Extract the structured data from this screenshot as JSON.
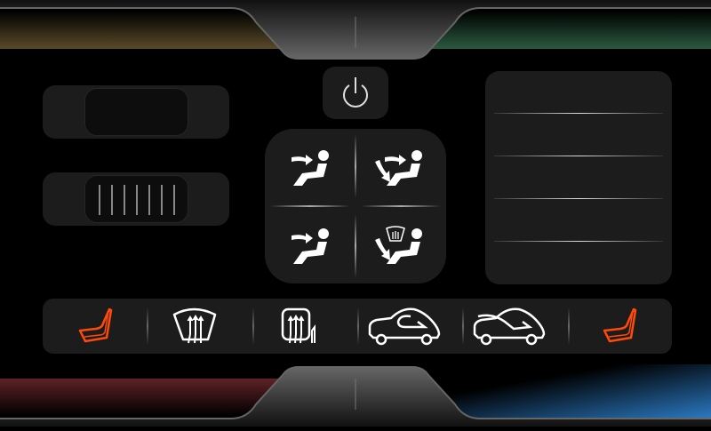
{
  "theme": {
    "background": "#000000",
    "panel": "#1c1c1c",
    "accent_seat_heat": "#ff4a0a",
    "top_left_band": "#5a4a28",
    "top_right_band": "#2a5a40",
    "bottom_left_band": "#5e2226",
    "bottom_right_band": "#2a78c0"
  },
  "controls": {
    "power": {
      "icon": "power-icon"
    },
    "temperature_slider": {
      "icon": "slider-knob"
    },
    "fan_slider": {
      "icon": "slider-grip",
      "grip_lines": 7
    },
    "airflow_modes": [
      {
        "icon": "face-vent-icon"
      },
      {
        "icon": "face-and-feet-vent-icon"
      },
      {
        "icon": "face-vent-icon"
      },
      {
        "icon": "feet-and-defrost-vent-icon"
      }
    ],
    "right_panel_rows": 4,
    "bottom_bar": [
      {
        "icon": "left-seat-heat-icon",
        "active": true
      },
      {
        "icon": "front-defrost-icon",
        "active": false
      },
      {
        "icon": "rear-defrost-icon",
        "active": false
      },
      {
        "icon": "recirculation-icon",
        "active": false
      },
      {
        "icon": "fresh-air-icon",
        "active": false
      },
      {
        "icon": "right-seat-heat-icon",
        "active": true
      }
    ]
  }
}
